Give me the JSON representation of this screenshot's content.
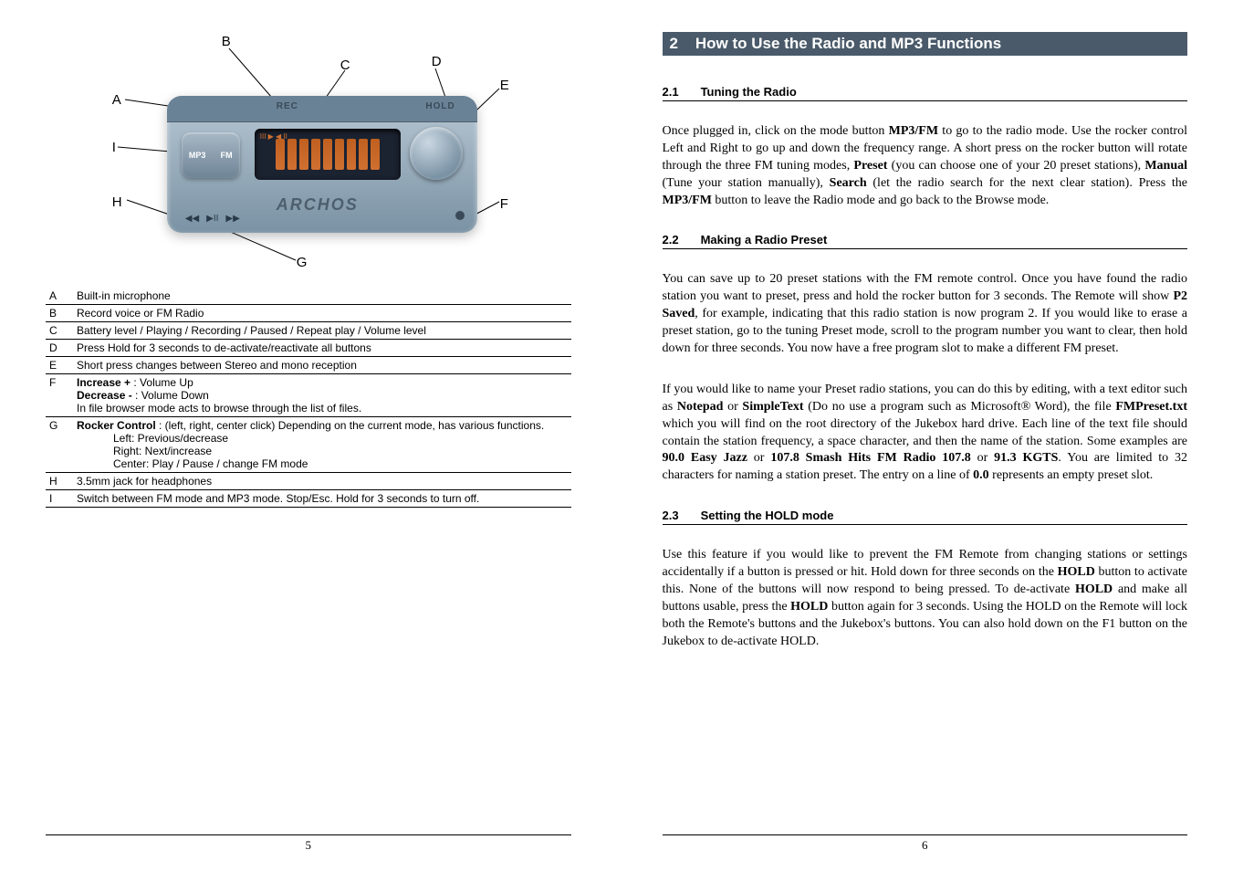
{
  "diagram": {
    "labels": {
      "A": "A",
      "B": "B",
      "C": "C",
      "D": "D",
      "E": "E",
      "F": "F",
      "G": "G",
      "H": "H",
      "I": "I"
    },
    "device": {
      "rec": "REC",
      "hold": "HOLD",
      "mp3": "MP3",
      "fm": "FM",
      "archos": "ARCHOS",
      "rew": "◀◀",
      "play": "▶II",
      "fwd": "▶▶"
    }
  },
  "legend": [
    {
      "key": "A",
      "text": "Built-in microphone"
    },
    {
      "key": "B",
      "text": "Record voice or FM Radio"
    },
    {
      "key": "C",
      "text": "Battery level / Playing / Recording / Paused / Repeat play / Volume level"
    },
    {
      "key": "D",
      "text": "Press Hold for 3 seconds to de-activate/reactivate all buttons"
    },
    {
      "key": "E",
      "text": "Short press changes between Stereo and mono reception"
    },
    {
      "key": "F",
      "lines": [
        {
          "bold": "Increase + ",
          "rest": ": Volume Up",
          "indent": false
        },
        {
          "bold": "Decrease - ",
          "rest": ": Volume Down",
          "indent": false
        },
        {
          "bold": "",
          "rest": "In file browser mode acts to browse through the list of files.",
          "indent": false
        }
      ]
    },
    {
      "key": "G",
      "lines": [
        {
          "bold": "Rocker Control ",
          "rest": ": (left, right, center click) Depending on the current mode, has various functions.",
          "indent": false
        },
        {
          "bold": "",
          "rest": "Left: Previous/decrease",
          "indent": true
        },
        {
          "bold": "",
          "rest": "Right: Next/increase",
          "indent": true
        },
        {
          "bold": "",
          "rest": "Center: Play / Pause / change FM mode",
          "indent": true
        }
      ]
    },
    {
      "key": "H",
      "text": "3.5mm jack for headphones"
    },
    {
      "key": "I",
      "text": "Switch between FM mode and MP3 mode. Stop/Esc. Hold for 3 seconds to turn off."
    }
  ],
  "left_page_number": "5",
  "right": {
    "section_number": "2",
    "section_title": "How to Use the Radio and MP3 Functions",
    "s21_num": "2.1",
    "s21_title": "Tuning the Radio",
    "s21_p1a": "Once plugged in, click on the mode button ",
    "s21_p1b": " to go to the radio mode. Use the rocker control Left and Right to go up and down the frequency range. A short press on the rocker button will rotate through the three FM tuning modes, ",
    "s21_p1c": " (you can choose one of your 20 preset stations), ",
    "s21_p1d": " (Tune your station manually), ",
    "s21_p1e": " (let the radio search for the next clear station). Press the ",
    "s21_p1f": " button to leave the Radio mode and go back to the Browse mode.",
    "bold_mp3fm": "MP3/FM",
    "bold_preset": "Preset",
    "bold_manual": "Manual",
    "bold_search": "Search",
    "s22_num": "2.2",
    "s22_title": "Making a Radio Preset",
    "s22_p1a": "You can save up to 20 preset stations with the FM remote control. Once you have found the radio station you want to preset, press and hold the rocker button for 3 seconds. The Remote will show ",
    "bold_p2saved": "P2 Saved",
    "s22_p1b": ", for example, indicating that this radio station is now program 2. If you would like to erase a preset station, go to the tuning Preset mode, scroll to the program number you want to clear, then hold down for three seconds. You now have a free program slot to make a different FM preset.",
    "s22_p2a": "If you would like to name your Preset radio stations, you can do this by editing, with a text editor such as ",
    "bold_notepad": "Notepad",
    "s22_p2b": " or ",
    "bold_simpletext": "SimpleText",
    "s22_p2c": " (Do no use a program such as Microsoft® Word), the file ",
    "bold_fmpreset": "FMPreset.txt",
    "s22_p2d": " which you will find on the root directory of the Jukebox hard drive. Each line of the text file should contain the station frequency, a space character, and then the name of the station. Some examples are ",
    "bold_ex1": "90.0 Easy Jazz",
    "s22_p2e": " or ",
    "bold_ex2": "107.8 Smash Hits FM Radio 107.8",
    "s22_p2f": " or ",
    "bold_ex3": "91.3 KGTS",
    "s22_p2g": ". You are limited to 32 characters for naming a station preset. The entry on a line of ",
    "bold_00": "0.0",
    "s22_p2h": " represents an empty preset slot.",
    "s23_num": "2.3",
    "s23_title": "Setting the HOLD mode",
    "s23_p1a": "Use this feature if you would like to prevent the FM Remote from changing stations or settings accidentally if a button is pressed or hit. Hold down for three seconds on the ",
    "bold_hold": "HOLD",
    "s23_p1b": " button to activate this. None of the buttons will now respond to being pressed. To de-activate ",
    "s23_p1c": " and make all buttons usable, press the ",
    "s23_p1d": " button again for 3 seconds. Using the HOLD on the Remote will lock both the Remote's buttons and the Jukebox's buttons. You can also hold down on the F1 button on the Jukebox to de-activate HOLD."
  },
  "right_page_number": "6"
}
